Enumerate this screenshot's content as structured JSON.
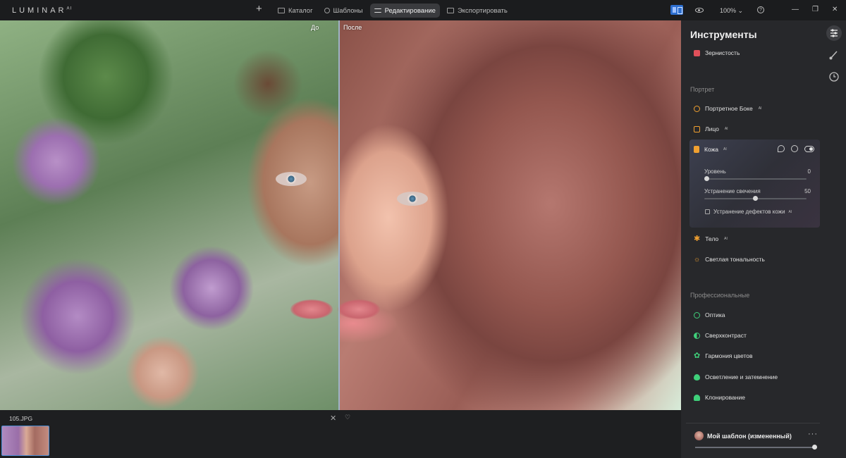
{
  "app": {
    "logo": "LUMINAR",
    "logo_sup": "AI"
  },
  "topbar": {
    "add_icon": "plus-icon",
    "tabs": [
      {
        "label": "Каталог",
        "icon": "folder-icon"
      },
      {
        "label": "Шаблоны",
        "icon": "presets-icon"
      },
      {
        "label": "Редактирование",
        "icon": "edit-icon",
        "active": true
      },
      {
        "label": "Экспортировать",
        "icon": "export-icon"
      }
    ],
    "zoom": "100%",
    "window_controls": [
      "—",
      "❐",
      "✕"
    ]
  },
  "canvas": {
    "before_label": "До",
    "after_label": "После"
  },
  "filmstrip": {
    "filename": "105.JPG",
    "close": "✕",
    "favorite": "♡"
  },
  "panel": {
    "title": "Инструменты",
    "tools_top": [
      {
        "label": "Зернистость",
        "ai": ""
      }
    ],
    "sections": {
      "portrait": "Портрет",
      "professional": "Профессиональные"
    },
    "portrait_tools": [
      {
        "label": "Портретное Боке",
        "ai": "AI"
      },
      {
        "label": "Лицо",
        "ai": "AI"
      }
    ],
    "skin": {
      "label": "Кожа",
      "ai": "AI",
      "sliders": [
        {
          "label": "Уровень",
          "value": "0",
          "fraction": 0.0
        },
        {
          "label": "Устранение свечения",
          "value": "50",
          "fraction": 0.5
        }
      ],
      "checkbox": {
        "label": "Устранение дефектов кожи",
        "ai": "AI",
        "checked": false
      }
    },
    "portrait_tools_after": [
      {
        "label": "Тело",
        "ai": "AI"
      },
      {
        "label": "Светлая тональность",
        "ai": ""
      }
    ],
    "pro_tools": [
      {
        "label": "Оптика"
      },
      {
        "label": "Сверхконтраст"
      },
      {
        "label": "Гармония цветов"
      },
      {
        "label": "Осветление и затемнение"
      },
      {
        "label": "Клонирование"
      }
    ],
    "preset": {
      "name": "Мой шаблон (измененный)",
      "more": "···",
      "amount": 1.0
    }
  },
  "colors": {
    "accent": "#2d6fd0",
    "panel_bg": "#27282b",
    "tool_icon": "#3fd07a",
    "grain_icon": "#e0505a",
    "portrait_icon": "#f0a030"
  }
}
